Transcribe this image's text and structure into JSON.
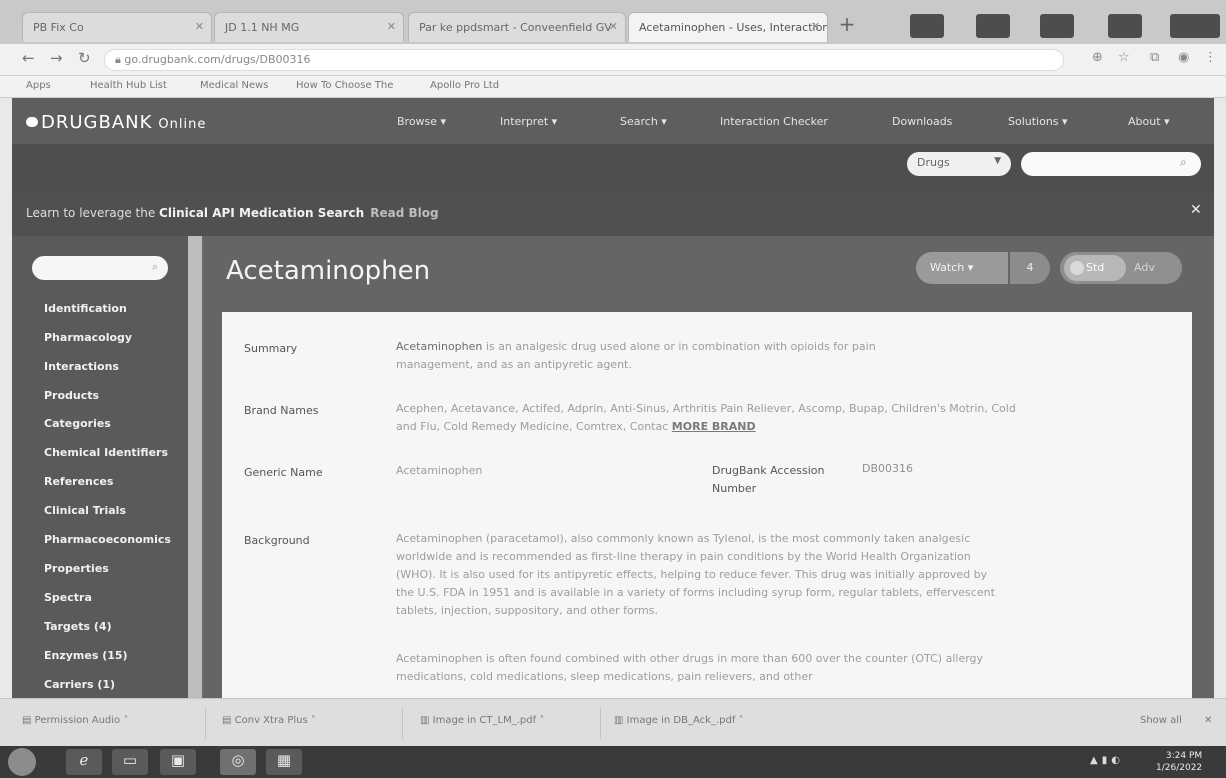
{
  "browser": {
    "tabs": [
      {
        "label": "PB Fix Co"
      },
      {
        "label": "JD 1.1 NH MG"
      },
      {
        "label": "Par ke ppdsmart - Conveenfield GV"
      },
      {
        "label": "Acetaminophen - Uses, Interactions ..."
      }
    ],
    "url": "go.drugbank.com/drugs/DB00316",
    "bookmarks": [
      "Apps",
      "Health Hub List",
      "Medical News",
      "How To Choose The",
      "Apollo Pro Ltd"
    ]
  },
  "site": {
    "logo": "DRUGBANK",
    "logo_sub": "Online",
    "nav": [
      "Browse ▾",
      "Interpret ▾",
      "Search ▾",
      "Interaction Checker",
      "Downloads",
      "Solutions ▾",
      "About ▾"
    ],
    "search": {
      "type": "Drugs",
      "placeholder": ""
    },
    "promo": {
      "prefix": "Learn to leverage the ",
      "bold": "Clinical API Medication Search",
      "link": "Read Blog"
    }
  },
  "sidebar": {
    "items": [
      {
        "label": "Identification"
      },
      {
        "label": "Pharmacology"
      },
      {
        "label": "Interactions"
      },
      {
        "label": "Products"
      },
      {
        "label": "Categories"
      },
      {
        "label": "Chemical Identifiers"
      },
      {
        "label": "References"
      },
      {
        "label": "Clinical Trials"
      },
      {
        "label": "Pharmacoeconomics"
      },
      {
        "label": "Properties"
      },
      {
        "label": "Spectra"
      },
      {
        "label": "Targets (4)"
      },
      {
        "label": "Enzymes (15)"
      },
      {
        "label": "Carriers (1)"
      }
    ]
  },
  "drug": {
    "title": "Acetaminophen",
    "watch_label": "Watch ▾",
    "watch_count": "4",
    "toggle": {
      "standard": "Std",
      "advanced": "Adv"
    },
    "fields": {
      "summary_label": "Summary",
      "summary_bold": "Acetaminophen",
      "summary_text": " is an analgesic drug used alone or in combination with opioids for pain management, and as an antipyretic agent.",
      "brand_label": "Brand Names",
      "brand_text": "Acephen, Acetavance, Actifed, Adprin, Anti-Sinus, Arthritis Pain Reliever, Ascomp, Bupap, Children's Motrin, Cold and Flu, Cold Remedy Medicine, Comtrex, Contac",
      "brand_more": "MORE BRAND",
      "generic_label": "Generic Name",
      "generic_value": "Acetaminophen",
      "accession_label": "DrugBank Accession Number",
      "accession_value": "DB00316",
      "background_label": "Background",
      "background_p1": "Acetaminophen (paracetamol), also commonly known as Tylenol, is the most commonly taken analgesic worldwide and is recommended as first-line therapy in pain conditions by the World Health Organization (WHO). It is also used for its antipyretic effects, helping to reduce fever. This drug was initially approved by the U.S. FDA in 1951 and is available in a variety of forms including syrup form, regular tablets, effervescent tablets, injection, suppository, and other forms.",
      "background_p2": "Acetaminophen is often found combined with other drugs in more than 600 over the counter (OTC) allergy medications, cold medications, sleep medications, pain relievers, and other"
    }
  },
  "downloads": [
    "Permission Audio",
    "Conv Xtra Plus",
    "Image in CT_LM_.pdf",
    "Image in DB_Ack_.pdf"
  ],
  "downloads_more": "Show all",
  "taskbar": {
    "time": "3:24 PM",
    "date": "1/26/2022"
  }
}
